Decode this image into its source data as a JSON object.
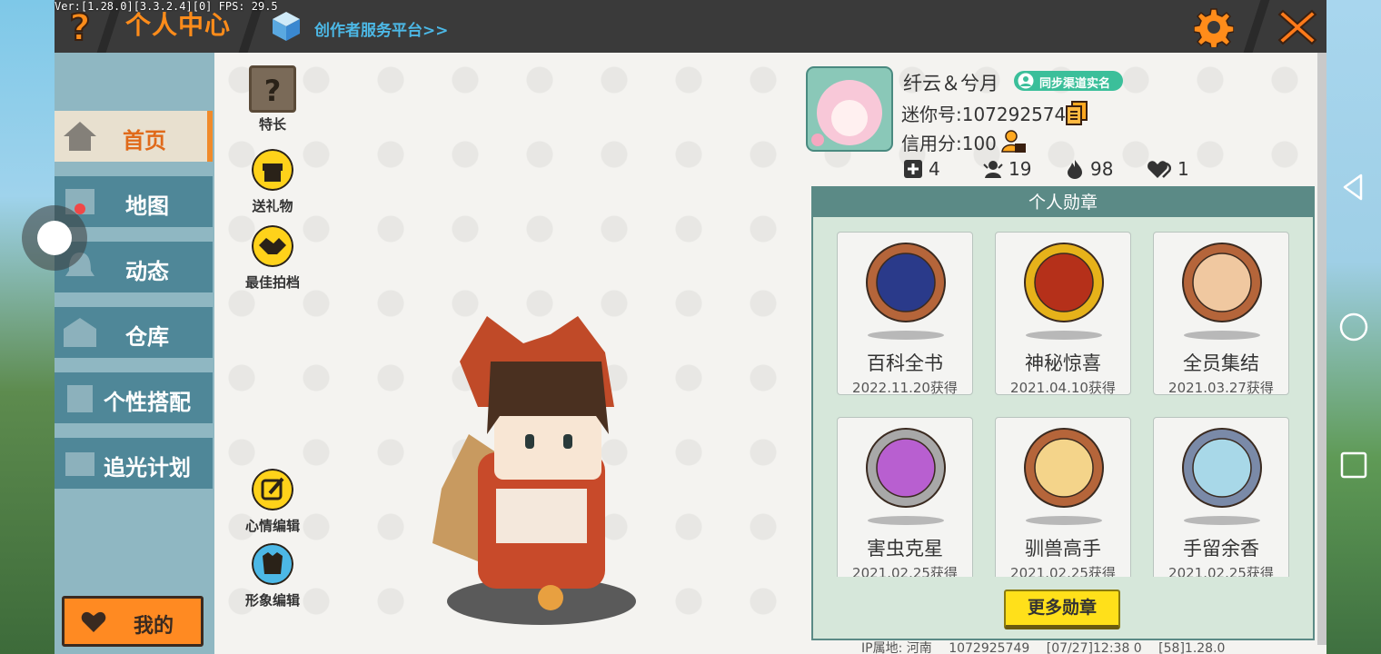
{
  "debug_text": "Ver:[1.28.0][3.3.2.4][0] FPS: 29.5",
  "header": {
    "title": "个人中心",
    "creator_link": "创作者服务平台>>"
  },
  "sidebar": {
    "items": [
      {
        "label": "首页",
        "active": true
      },
      {
        "label": "地图",
        "active": false
      },
      {
        "label": "动态",
        "active": false
      },
      {
        "label": "仓库",
        "active": false
      },
      {
        "label": "个性搭配",
        "active": false
      },
      {
        "label": "追光计划",
        "active": false
      }
    ],
    "mine_label": "我的"
  },
  "actions": {
    "specialty": "特长",
    "gift": "送礼物",
    "partner": "最佳拍档",
    "mood": "心情编辑",
    "look": "形象编辑"
  },
  "profile": {
    "name": "纤云＆兮月",
    "badge": "同步渠道实名",
    "mini_id": "迷你号:1072925749",
    "credit": "信用分:100",
    "stats": {
      "plus": "4",
      "fans": "19",
      "heat": "98",
      "likes": "1"
    }
  },
  "medals": {
    "header": "个人勋章",
    "items": [
      {
        "name": "百科全书",
        "date": "2022.11.20获得",
        "ring": "#b5653a",
        "face": "#2a3a8a"
      },
      {
        "name": "神秘惊喜",
        "date": "2021.04.10获得",
        "ring": "#e6b21a",
        "face": "#b5301a"
      },
      {
        "name": "全员集结",
        "date": "2021.03.27获得",
        "ring": "#b5653a",
        "face": "#f0c8a0"
      },
      {
        "name": "害虫克星",
        "date": "2021.02.25获得",
        "ring": "#a8a8a8",
        "face": "#b85fd0"
      },
      {
        "name": "驯兽高手",
        "date": "2021.02.25获得",
        "ring": "#b5653a",
        "face": "#f4d48a"
      },
      {
        "name": "手留余香",
        "date": "2021.02.25获得",
        "ring": "#7a8aa8",
        "face": "#a8d8e8"
      }
    ],
    "more": "更多勋章"
  },
  "footer": {
    "ip": "IP属地: 河南",
    "uid": "1072925749",
    "time": "[07/27]12:38 0",
    "ver": "[58]1.28.0"
  },
  "colors": {
    "accent": "#ff8c1a",
    "sidebar": "#4f8798",
    "panel": "#5b8a86"
  }
}
